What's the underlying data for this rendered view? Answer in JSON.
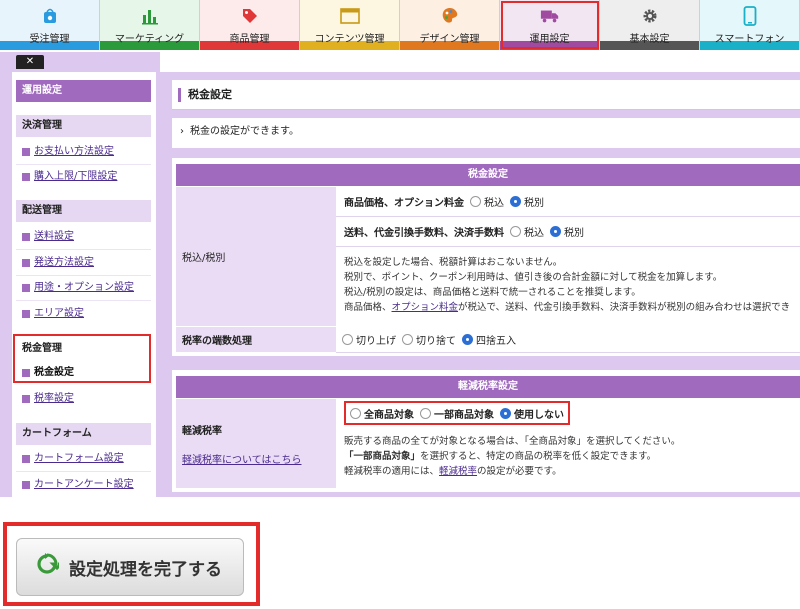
{
  "nav": {
    "tabs": [
      {
        "label": "受注管理",
        "icon": "order-bag-icon",
        "color": "#2b9be0",
        "bg": "#e8f4fb"
      },
      {
        "label": "マーケティング",
        "icon": "bar-chart-icon",
        "color": "#2a9a3a",
        "bg": "#e6f6e8"
      },
      {
        "label": "商品管理",
        "icon": "price-tag-icon",
        "color": "#e03838",
        "bg": "#fdeaea"
      },
      {
        "label": "コンテンツ管理",
        "icon": "window-icon",
        "color": "#e0b020",
        "bg": "#fdf6e0"
      },
      {
        "label": "デザイン管理",
        "icon": "palette-icon",
        "color": "#e07820",
        "bg": "#fdefe2"
      },
      {
        "label": "運用設定",
        "icon": "truck-icon",
        "color": "#a04aa0",
        "bg": "#f2e6f2"
      },
      {
        "label": "基本設定",
        "icon": "gear-icon",
        "color": "#555555",
        "bg": "#eeeeee"
      },
      {
        "label": "スマートフォン",
        "icon": "smartphone-icon",
        "color": "#1ab0c8",
        "bg": "#e4f7fa"
      }
    ]
  },
  "close_label": "✕",
  "sidebar": {
    "header": "運用設定",
    "groups": {
      "payment": "決済管理",
      "shipping": "配送管理",
      "tax": "税金管理",
      "cart": "カートフォーム"
    },
    "items": {
      "payment_method": "お支払い方法設定",
      "purchase_limit": "購入上限/下限設定",
      "shipping_fee": "送料設定",
      "shipping_method": "発送方法設定",
      "packaging": "用途・オプション設定",
      "area": "エリア設定",
      "tax_setting": "税金設定",
      "tax_rate": "税率設定",
      "cart_form": "カートフォーム設定",
      "cart_survey": "カートアンケート設定"
    }
  },
  "page": {
    "title": "税金設定",
    "description": "税金の設定ができます。"
  },
  "tax_table": {
    "header": "税金設定",
    "row_inclusive_label": "税込/税別",
    "line1_label": "商品価格、オプション料金",
    "line2_label": "送料、代金引換手数料、決済手数料",
    "opt_incl": "税込",
    "opt_excl": "税別",
    "notes": {
      "n1": "税込を設定した場合、税額計算はおこないません。",
      "n2": "税別で、ポイント、クーポン利用時は、値引き後の合計金額に対して税金を加算します。",
      "n3": "税込/税別の設定は、商品価格と送料で統一されることを推奨します。",
      "n4a": "商品価格、",
      "n4link": "オプション料金",
      "n4b": "が税込で、送料、代金引換手数料、決済手数料が税別の組み合わせは選択でき"
    },
    "rounding_label": "税率の端数処理",
    "round_up": "切り上げ",
    "round_down": "切り捨て",
    "round_half": "四捨五入"
  },
  "reduced_table": {
    "header": "軽減税率設定",
    "label": "軽減税率",
    "help_link": "軽減税率についてはこちら",
    "opt_all": "全商品対象",
    "opt_some": "一部商品対象",
    "opt_none": "使用しない",
    "notes": {
      "n1": "販売する商品の全てが対象となる場合は、「全商品対象」を選択してください。",
      "n2a": "「一部商品対象」",
      "n2b": "を選択すると、特定の商品の税率を低く設定できます。",
      "n3a": "軽減税率の適用には、",
      "n3link": "軽減税率",
      "n3b": "の設定が必要です。"
    }
  },
  "complete_button": "設定処理を完了する"
}
